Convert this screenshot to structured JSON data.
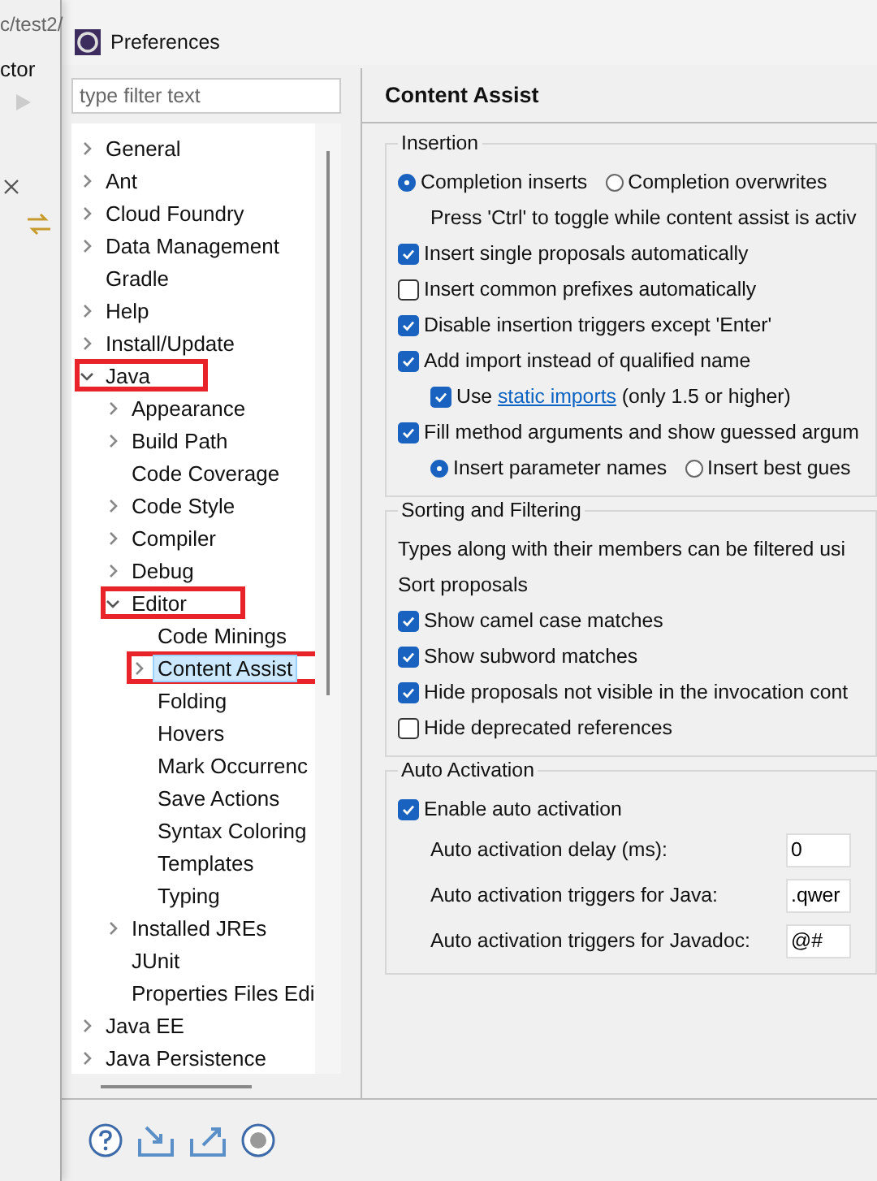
{
  "background": {
    "path": "c/test2/",
    "menu_label": "ctor"
  },
  "window": {
    "title": "Preferences"
  },
  "filter": {
    "placeholder": "type filter text"
  },
  "tree": [
    {
      "label": "General",
      "expanded": false,
      "selected": false
    },
    {
      "label": "Ant",
      "expanded": false,
      "selected": false
    },
    {
      "label": "Cloud Foundry",
      "expanded": false,
      "selected": false
    },
    {
      "label": "Data Management",
      "expanded": false,
      "selected": false
    },
    {
      "label": "Gradle",
      "selected": false
    },
    {
      "label": "Help",
      "expanded": false,
      "selected": false
    },
    {
      "label": "Install/Update",
      "expanded": false,
      "selected": false
    },
    {
      "label": "Java",
      "expanded": true,
      "selected": false,
      "highlighted": true,
      "children": [
        {
          "label": "Appearance",
          "expanded": false,
          "selected": false
        },
        {
          "label": "Build Path",
          "expanded": false,
          "selected": false
        },
        {
          "label": "Code Coverage",
          "selected": false
        },
        {
          "label": "Code Style",
          "expanded": false,
          "selected": false
        },
        {
          "label": "Compiler",
          "expanded": false,
          "selected": false
        },
        {
          "label": "Debug",
          "expanded": false,
          "selected": false
        },
        {
          "label": "Editor",
          "expanded": true,
          "selected": false,
          "highlighted": true,
          "children": [
            {
              "label": "Code Minings",
              "selected": false
            },
            {
              "label": "Content Assist",
              "expanded": false,
              "selected": true,
              "highlighted": true
            },
            {
              "label": "Folding",
              "selected": false
            },
            {
              "label": "Hovers",
              "selected": false
            },
            {
              "label": "Mark Occurrenc",
              "selected": false
            },
            {
              "label": "Save Actions",
              "selected": false
            },
            {
              "label": "Syntax Coloring",
              "selected": false
            },
            {
              "label": "Templates",
              "selected": false
            },
            {
              "label": "Typing",
              "selected": false
            }
          ]
        },
        {
          "label": "Installed JREs",
          "expanded": false,
          "selected": false
        },
        {
          "label": "JUnit",
          "selected": false
        },
        {
          "label": "Properties Files Edi",
          "selected": false
        }
      ]
    },
    {
      "label": "Java EE",
      "expanded": false,
      "selected": false
    },
    {
      "label": "Java Persistence",
      "expanded": false,
      "selected": false
    }
  ],
  "page": {
    "title": "Content Assist",
    "groups": [
      {
        "title": "Insertion",
        "rows": [
          {
            "kind": "radios",
            "options": [
              {
                "label": "Completion inserts",
                "selected": true
              },
              {
                "label": "Completion overwrites",
                "selected": false
              }
            ]
          },
          {
            "kind": "hint",
            "text": "Press 'Ctrl' to toggle while content assist is activ"
          },
          {
            "kind": "checkbox",
            "label": "Insert single proposals automatically",
            "checked": true
          },
          {
            "kind": "checkbox",
            "label": "Insert common prefixes automatically",
            "checked": false
          },
          {
            "kind": "checkbox",
            "label": "Disable insertion triggers except 'Enter'",
            "checked": true
          },
          {
            "kind": "checkbox",
            "label": "Add import instead of qualified name",
            "checked": true,
            "children": [
              {
                "kind": "linkcheckbox",
                "before": "Use ",
                "link": "static imports",
                "after": " (only 1.5 or higher)",
                "checked": true
              }
            ]
          },
          {
            "kind": "checkbox",
            "label": "Fill method arguments and show guessed argum",
            "checked": true,
            "children": [
              {
                "kind": "radios",
                "options": [
                  {
                    "label": "Insert parameter names",
                    "selected": true
                  },
                  {
                    "label": "Insert best gues",
                    "selected": false
                  }
                ]
              }
            ]
          }
        ]
      },
      {
        "title": "Sorting and Filtering",
        "rows": [
          {
            "kind": "note",
            "text": "Types along with their members can be filtered usi"
          },
          {
            "kind": "note",
            "text": "Sort proposals"
          },
          {
            "kind": "checkbox",
            "label": "Show camel case matches",
            "checked": true
          },
          {
            "kind": "checkbox",
            "label": "Show subword matches",
            "checked": true
          },
          {
            "kind": "checkbox",
            "label": "Hide proposals not visible in the invocation cont",
            "checked": true
          },
          {
            "kind": "checkbox",
            "label": "Hide deprecated references",
            "checked": false
          }
        ]
      },
      {
        "title": "Auto Activation",
        "rows": [
          {
            "kind": "checkbox",
            "label": "Enable auto activation",
            "checked": true,
            "children": [
              {
                "kind": "field",
                "label": "Auto activation delay (ms):",
                "value": "0"
              },
              {
                "kind": "field",
                "label": "Auto activation triggers for Java:",
                "value": ".qwer"
              },
              {
                "kind": "field",
                "label": "Auto activation triggers for Javadoc:",
                "value": "@#"
              }
            ]
          }
        ]
      }
    ]
  }
}
